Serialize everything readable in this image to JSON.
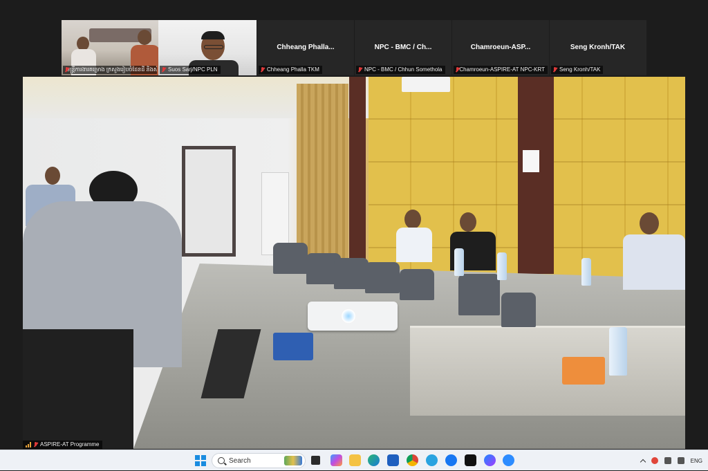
{
  "participants": [
    {
      "caption": "មន្ត្រីការងារគម្រោង ក្រសួងរៀបចំដែនដី និងសំណង់",
      "type": "video"
    },
    {
      "caption": "Suos Sarj/NPC PLN",
      "type": "video"
    },
    {
      "display_name": "Chheang  Phalla...",
      "caption": "Chheang Phalla TKM",
      "type": "name"
    },
    {
      "display_name": "NPC - BMC /   Ch...",
      "caption": "NPC - BMC /  Chhun Somethola",
      "type": "name"
    },
    {
      "display_name": "Chamroeun-ASP...",
      "caption": "Chamroeun-ASPIRE-AT NPC-KRT",
      "type": "name"
    },
    {
      "display_name": "Seng Kronh/TAK",
      "caption": "Seng Kronh/TAK",
      "type": "name"
    }
  ],
  "main_video": {
    "caption": "ASPIRE-AT Programme"
  },
  "taskbar": {
    "search_label": "Search",
    "language": "ENG",
    "apps": [
      "task-view",
      "copilot",
      "file-explorer",
      "edge",
      "store",
      "chrome",
      "telegram",
      "facebook",
      "tiktok",
      "messenger",
      "zoom"
    ]
  }
}
